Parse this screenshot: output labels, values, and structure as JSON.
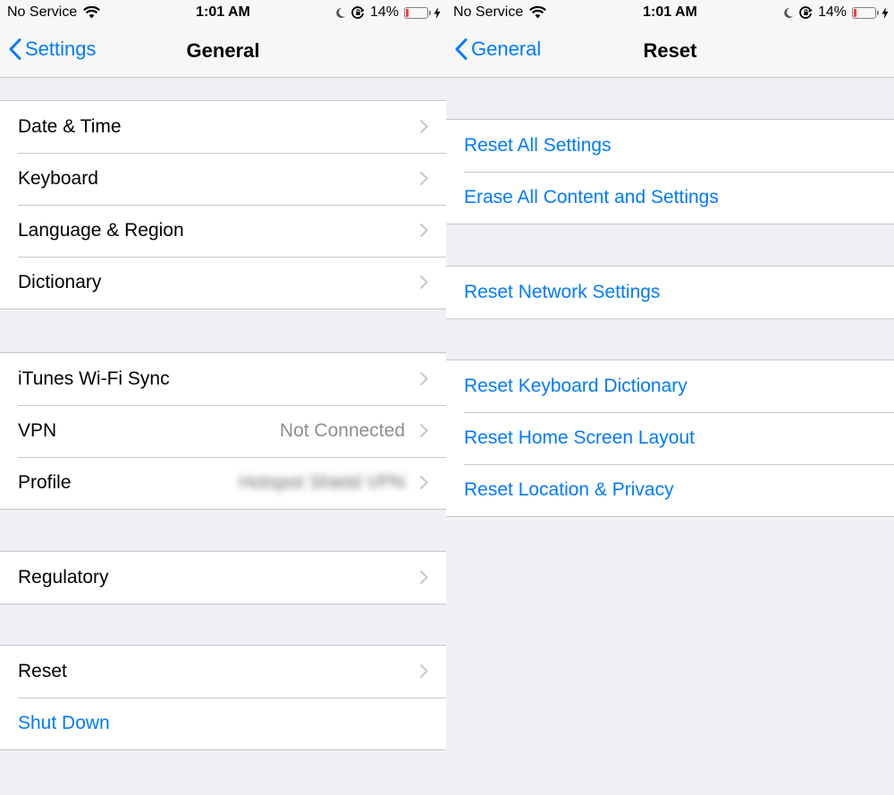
{
  "left": {
    "status": {
      "carrier": "No Service",
      "time": "1:01 AM",
      "battery": "14%",
      "battery_level": 0.14
    },
    "nav": {
      "back": "Settings",
      "title": "General"
    },
    "groups": [
      {
        "items": [
          {
            "label": "Date & Time"
          },
          {
            "label": "Keyboard"
          },
          {
            "label": "Language & Region"
          },
          {
            "label": "Dictionary"
          }
        ]
      },
      {
        "items": [
          {
            "label": "iTunes Wi-Fi Sync"
          },
          {
            "label": "VPN",
            "value": "Not Connected"
          },
          {
            "label": "Profile",
            "value": "Hotspot Shield VPN"
          }
        ]
      },
      {
        "items": [
          {
            "label": "Regulatory"
          }
        ]
      },
      {
        "items": [
          {
            "label": "Reset"
          },
          {
            "label": "Shut Down"
          }
        ]
      }
    ]
  },
  "right": {
    "status": {
      "carrier": "No Service",
      "time": "1:01 AM",
      "battery": "14%",
      "battery_level": 0.14
    },
    "nav": {
      "back": "General",
      "title": "Reset"
    },
    "groups": [
      {
        "items": [
          {
            "label": "Reset All Settings"
          },
          {
            "label": "Erase All Content and Settings"
          }
        ]
      },
      {
        "items": [
          {
            "label": "Reset Network Settings"
          }
        ]
      },
      {
        "items": [
          {
            "label": "Reset Keyboard Dictionary"
          },
          {
            "label": "Reset Home Screen Layout"
          },
          {
            "label": "Reset Location & Privacy"
          }
        ]
      }
    ]
  },
  "colors": {
    "accent": "#007aff",
    "background": "#efeff4",
    "battery_low": "#ff3b30"
  },
  "icons": [
    "wifi-icon",
    "moon-icon",
    "orientation-lock-icon",
    "battery-icon",
    "charging-bolt-icon",
    "back-chevron-icon",
    "chevron-right-icon"
  ]
}
